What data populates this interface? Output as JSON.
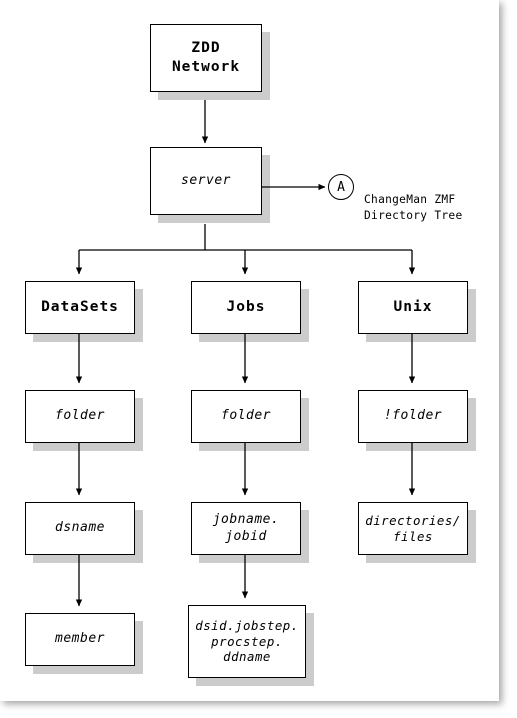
{
  "diagram": {
    "title_node": {
      "label": "ZDD\nNetwork"
    },
    "server_node": {
      "label": "server"
    },
    "marker": {
      "label": "A"
    },
    "annotation": {
      "text": "ChangeMan ZMF\nDirectory Tree"
    },
    "columns": [
      {
        "key": "datasets",
        "root": "DataSets",
        "levels": [
          "folder",
          "dsname",
          "member"
        ]
      },
      {
        "key": "jobs",
        "root": "Jobs",
        "levels": [
          "folder",
          "jobname.\njobid",
          "dsid.jobstep.\nprocstep.\nddname"
        ]
      },
      {
        "key": "unix",
        "root": "Unix",
        "levels": [
          "!folder",
          "directories/\nfiles"
        ]
      }
    ],
    "colors": {
      "box_border": "#000000",
      "box_fill": "#ffffff",
      "drop_shadow": "#cccccc",
      "connector": "#000000",
      "page": "#ffffff"
    }
  }
}
